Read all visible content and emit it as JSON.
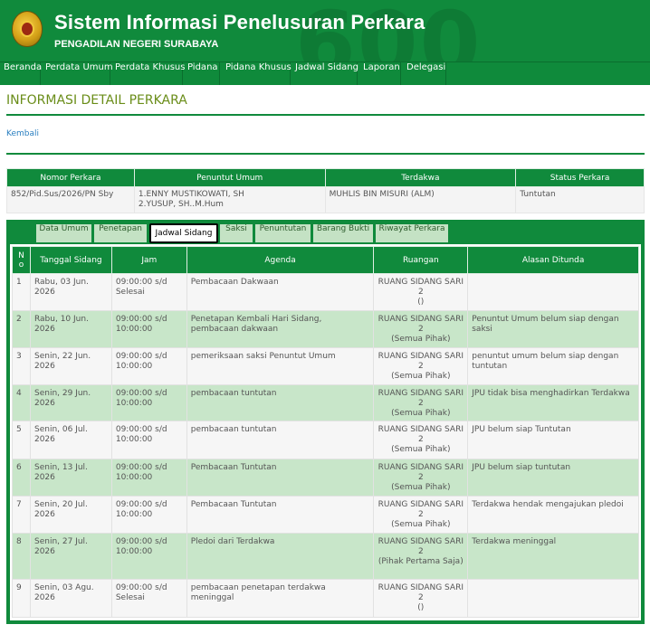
{
  "header": {
    "title": "Sistem Informasi Penelusuran Perkara",
    "subtitle": "PENGADILAN NEGERI SURABAYA",
    "watermark": "600"
  },
  "nav": [
    "Beranda",
    "Perdata Umum",
    "Perdata Khusus",
    "Pidana",
    "Pidana Khusus",
    "Jadwal Sidang",
    "Laporan",
    "Delegasi"
  ],
  "page": {
    "title": "INFORMASI DETAIL PERKARA",
    "back_link": "Kembali"
  },
  "case_info": {
    "headers": [
      "Nomor Perkara",
      "Penuntut Umum",
      "Terdakwa",
      "Status Perkara"
    ],
    "nomor": "852/Pid.Sus/2026/PN Sby",
    "penuntut_1": "1.ENNY MUSTIKOWATI, SH",
    "penuntut_2": "2.YUSUP, SH..M.Hum",
    "terdakwa": "MUHLIS BIN MISURI (ALM)",
    "status": "Tuntutan"
  },
  "tabs": [
    "Data Umum",
    "Penetapan",
    "Jadwal Sidang",
    "Saksi",
    "Penuntutan",
    "Barang Bukti",
    "Riwayat Perkara"
  ],
  "active_tab": "Jadwal Sidang",
  "schedule": {
    "headers": {
      "no_1": "N",
      "no_2": "o",
      "tanggal": "Tanggal Sidang",
      "jam": "Jam",
      "agenda": "Agenda",
      "ruangan": "Ruangan",
      "alasan": "Alasan Ditunda"
    },
    "rows": [
      {
        "no": "1",
        "tanggal": "Rabu, 03 Jun. 2026",
        "jam": "09:00:00 s/d Selesai",
        "agenda": "Pembacaan Dakwaan",
        "ruangan_1": "RUANG SIDANG SARI 2",
        "ruangan_2": "()",
        "alasan": ""
      },
      {
        "no": "2",
        "tanggal": "Rabu, 10 Jun. 2026",
        "jam": "09:00:00 s/d 10:00:00",
        "agenda": "Penetapan Kembali Hari Sidang, pembacaan dakwaan",
        "ruangan_1": "RUANG SIDANG SARI 2",
        "ruangan_2": "(Semua Pihak)",
        "alasan": "Penuntut Umum belum siap dengan saksi"
      },
      {
        "no": "3",
        "tanggal": "Senin, 22 Jun. 2026",
        "jam": "09:00:00 s/d 10:00:00",
        "agenda": "pemeriksaan saksi Penuntut Umum",
        "ruangan_1": "RUANG SIDANG SARI 2",
        "ruangan_2": "(Semua Pihak)",
        "alasan": "penuntut umum belum siap dengan tuntutan"
      },
      {
        "no": "4",
        "tanggal": "Senin, 29 Jun. 2026",
        "jam": "09:00:00 s/d 10:00:00",
        "agenda": "pembacaan tuntutan",
        "ruangan_1": "RUANG SIDANG SARI 2",
        "ruangan_2": "(Semua Pihak)",
        "alasan": "JPU tidak bisa menghadirkan Terdakwa"
      },
      {
        "no": "5",
        "tanggal": "Senin, 06 Jul. 2026",
        "jam": "09:00:00 s/d 10:00:00",
        "agenda": "pembacaan tuntutan",
        "ruangan_1": "RUANG SIDANG SARI 2",
        "ruangan_2": "(Semua Pihak)",
        "alasan": "JPU belum siap Tuntutan"
      },
      {
        "no": "6",
        "tanggal": "Senin, 13 Jul. 2026",
        "jam": "09:00:00 s/d 10:00:00",
        "agenda": "Pembacaan Tuntutan",
        "ruangan_1": "RUANG SIDANG SARI 2",
        "ruangan_2": "(Semua Pihak)",
        "alasan": "JPU belum siap tuntutan"
      },
      {
        "no": "7",
        "tanggal": "Senin, 20 Jul. 2026",
        "jam": "09:00:00 s/d 10:00:00",
        "agenda": "Pembacaan Tuntutan",
        "ruangan_1": "RUANG SIDANG SARI 2",
        "ruangan_2": "(Semua Pihak)",
        "alasan": "Terdakwa hendak mengajukan pledoi"
      },
      {
        "no": "8",
        "tanggal": "Senin, 27 Jul. 2026",
        "jam": "09:00:00 s/d 10:00:00",
        "agenda": "Pledoi dari Terdakwa",
        "ruangan_1": "RUANG SIDANG SARI 2",
        "ruangan_2": "(Pihak Pertama Saja)",
        "alasan": "Terdakwa meninggal"
      },
      {
        "no": "9",
        "tanggal": "Senin, 03 Agu. 2026",
        "jam": "09:00:00 s/d Selesai",
        "agenda": "pembacaan penetapan terdakwa meninggal",
        "ruangan_1": "RUANG SIDANG SARI 2",
        "ruangan_2": "()",
        "alasan": ""
      }
    ]
  },
  "colors": {
    "brand_green": "#108a3c",
    "row_green": "#c8e6c9",
    "title_olive": "#6a8d19",
    "link_blue": "#2a7fc0"
  }
}
